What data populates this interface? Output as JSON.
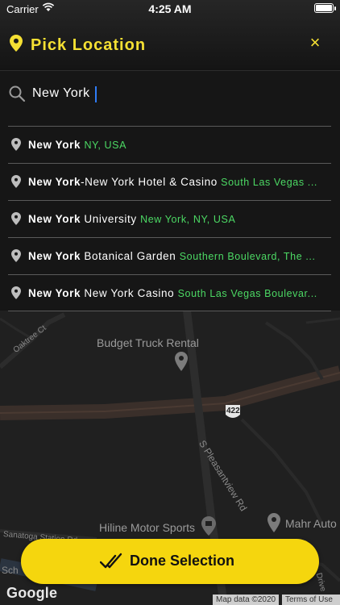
{
  "status_bar": {
    "carrier": "Carrier",
    "time": "4:25 AM"
  },
  "header": {
    "title": "Pick Location",
    "close_symbol": "×"
  },
  "search": {
    "value": "New York",
    "placeholder": ""
  },
  "results": [
    {
      "bold": "New York",
      "plain": "",
      "secondary": "NY, USA"
    },
    {
      "bold": "New York",
      "plain": "-New York Hotel & Casino",
      "secondary": "South Las Vegas ..."
    },
    {
      "bold": "New York",
      "plain": " University",
      "secondary": "New York, NY, USA"
    },
    {
      "bold": "New York",
      "plain": " Botanical Garden",
      "secondary": "Southern Boulevard, The ..."
    },
    {
      "bold": "New York",
      "plain": " New York Casino",
      "secondary": "South Las Vegas Boulevar..."
    }
  ],
  "map": {
    "labels": {
      "budget": "Budget Truck Rental",
      "oaktree": "Oaktree Ct",
      "route": "422",
      "pleasantview": "S Pleasantview Rd",
      "hiline": "Hiline Motor Sports",
      "mahr": "Mahr Auto",
      "sanatoga": "Sanatoga Station Rd",
      "sch": "Sch",
      "drive": "Drive"
    },
    "google": "Google",
    "map_data": "Map data ©2020",
    "terms": "Terms of Use"
  },
  "done_button": {
    "label": "Done Selection"
  },
  "colors": {
    "accent_yellow": "#f5e033",
    "button_yellow": "#f5d60e",
    "secondary_green": "#4cd964"
  }
}
